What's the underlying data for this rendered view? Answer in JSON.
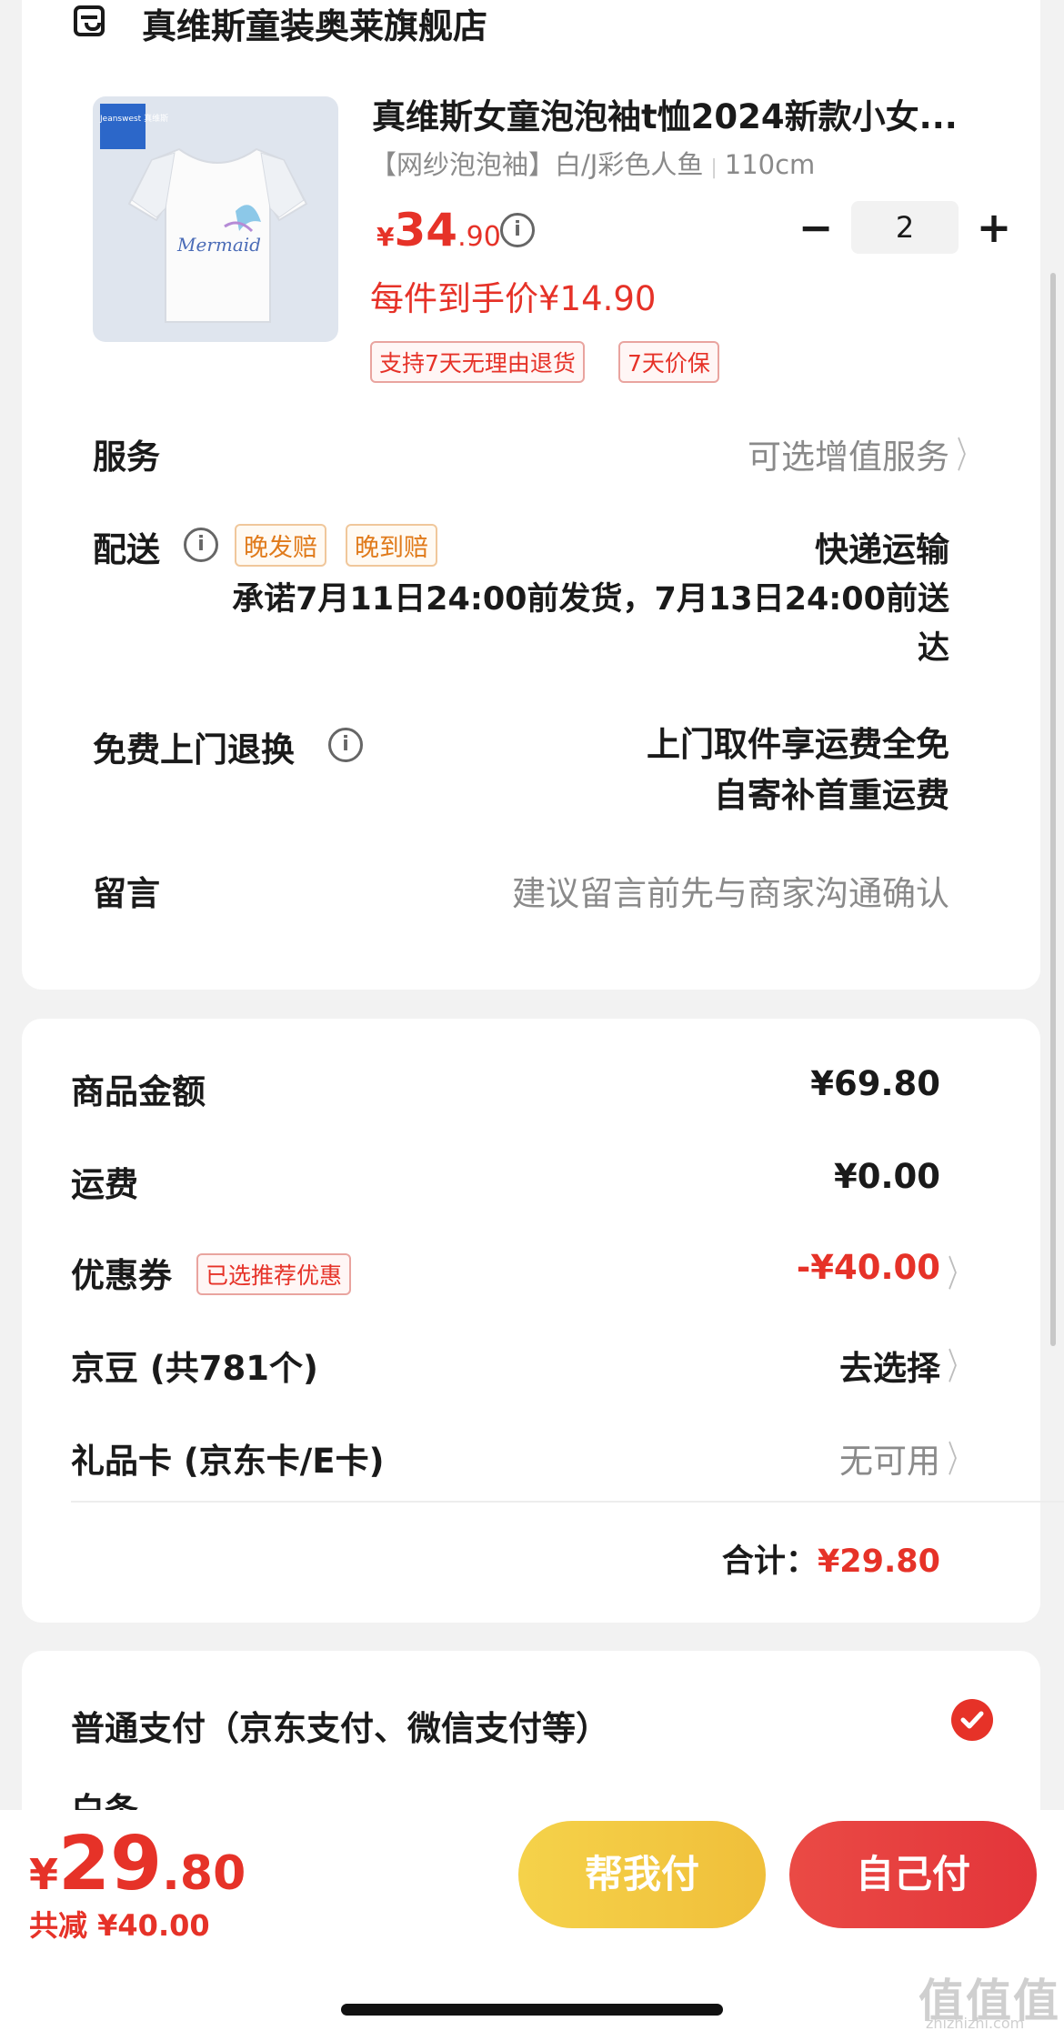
{
  "store": {
    "name": "真维斯童装奥莱旗舰店"
  },
  "product": {
    "title": "真维斯女童泡泡袖t恤2024新款小女...",
    "spec_variant": "【网纱泡泡袖】白/J彩色人鱼",
    "spec_size": "110cm",
    "price_currency": "¥",
    "price_int": "34",
    "price_dec": ".90",
    "unit_price": "每件到手价¥14.90",
    "quantity": "2",
    "minus": "−",
    "plus": "+",
    "brand_logo_text": "Jeanswest 真维斯",
    "shirt_text": "Mermaid",
    "tags": [
      "支持7天无理由退货",
      "7天价保"
    ]
  },
  "service": {
    "label": "服务",
    "value": "可选增值服务"
  },
  "delivery": {
    "label": "配送",
    "tags": [
      "晚发赔",
      "晚到赔"
    ],
    "method": "快递运输",
    "promise_line1": "承诺7月11日24:00前发货，7月13日24:00前送",
    "promise_line2": "达"
  },
  "return": {
    "label": "免费上门退换",
    "line1": "上门取件享运费全免",
    "line2": "自寄补首重运费"
  },
  "message": {
    "label": "留言",
    "placeholder": "建议留言前先与商家沟通确认"
  },
  "summary": {
    "goods_label": "商品金额",
    "goods_value": "¥69.80",
    "shipping_label": "运费",
    "shipping_value": "¥0.00",
    "coupon_label": "优惠券",
    "coupon_tag": "已选推荐优惠",
    "coupon_value": "-¥40.00",
    "jingdou_label": "京豆 (共781个)",
    "jingdou_value": "去选择",
    "giftcard_label": "礼品卡 (京东卡/E卡)",
    "giftcard_value": "无可用",
    "total_label": "合计：",
    "total_value": "¥29.80"
  },
  "payment": {
    "option1": "普通支付（京东支付、微信支付等）",
    "option2_partial": "白条"
  },
  "bottom": {
    "currency": "¥",
    "total_int": "29",
    "total_dec": ".80",
    "discount": "共减 ¥40.00",
    "help_pay": "帮我付",
    "self_pay": "自己付"
  },
  "watermark": {
    "main": "值值值",
    "sub": "zhizhizhi.com"
  },
  "colors": {
    "accent_red": "#e63228",
    "help_pay_yellow": "#f2c53d",
    "self_pay_red": "#e8413e"
  }
}
